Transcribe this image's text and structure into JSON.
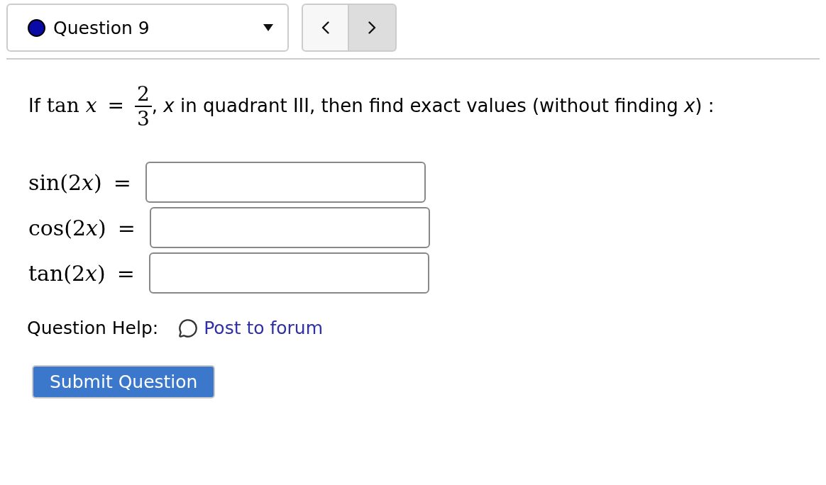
{
  "question_selector": {
    "label": "Question 9"
  },
  "navigation": [
    {
      "kind": "previous",
      "highlighted": false
    },
    {
      "kind": "next",
      "highlighted": true
    }
  ],
  "prompt": {
    "lead": "If",
    "expression": "tan *x*",
    "relation": "=",
    "fraction": {
      "numerator": "2",
      "denominator": "3"
    },
    "rest": ", *x* in quadrant III, then find exact values (without finding *x*) :"
  },
  "answers": [
    {
      "expression": [
        {
          "text": "sin(2",
          "italic": false
        },
        {
          "text": "x",
          "italic": true
        },
        {
          "text": ")",
          "italic": false
        }
      ],
      "relation": "="
    },
    {
      "expression": [
        {
          "text": "cos(2",
          "italic": false
        },
        {
          "text": "x",
          "italic": true
        },
        {
          "text": ")",
          "italic": false
        }
      ],
      "relation": "="
    },
    {
      "expression": [
        {
          "text": "tan(2",
          "italic": false
        },
        {
          "text": "x",
          "italic": true
        },
        {
          "text": ")",
          "italic": false
        }
      ],
      "relation": "="
    }
  ],
  "help": {
    "label": "Question Help:",
    "link": "Post to forum"
  },
  "submit_button": {
    "label": "Submit Question"
  }
}
